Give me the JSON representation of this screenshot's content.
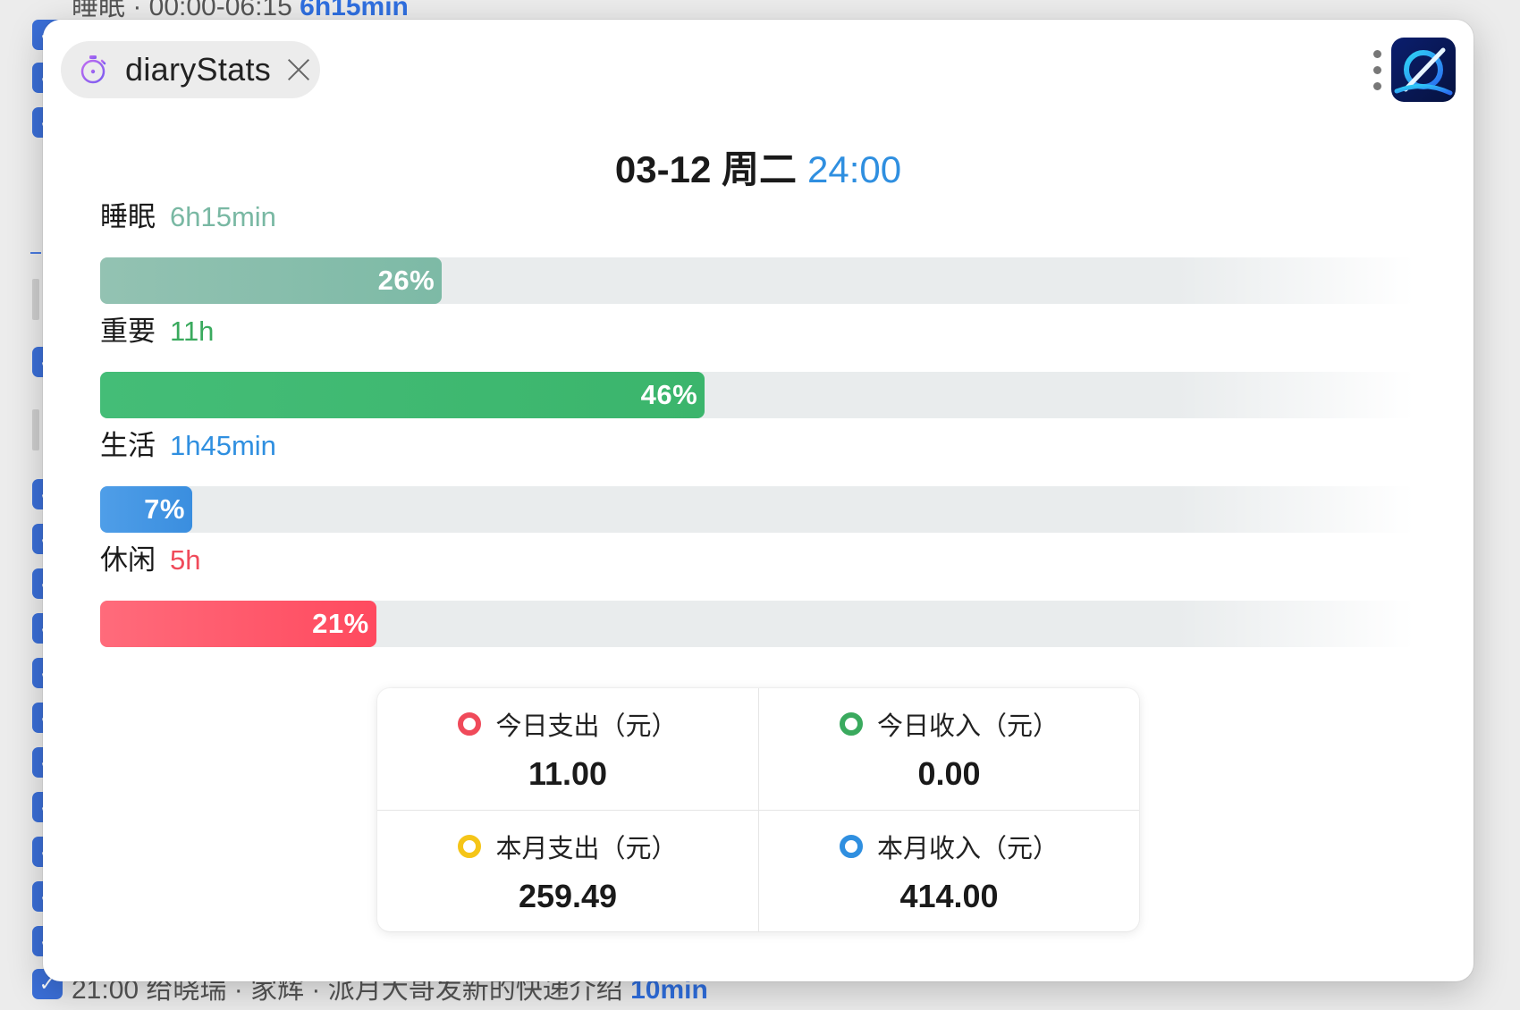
{
  "background_app": {
    "top_line": {
      "text": "睡眠 · 00:00-06:15",
      "highlight": "6h15min"
    },
    "bottom_line": {
      "text": "21:00 给晓瑞 · 家辉 · 派月大哥发新的快递介绍",
      "highlight": "10min"
    }
  },
  "tab": {
    "label": "diaryStats",
    "icon": "stopwatch-icon",
    "close_icon": "close-icon"
  },
  "header": {
    "menu_icon": "more-vertical-icon",
    "logo_icon": "app-logo-icon"
  },
  "date": {
    "day": "03-12 周二",
    "time": "24:00",
    "time_color": "#2f8fe0"
  },
  "categories": [
    {
      "name": "睡眠",
      "duration": "6h15min",
      "percent_label": "26%",
      "percent": 26,
      "color": "#7dbaa6",
      "color_light": "#93c2b2",
      "duration_color": "#79b8a3"
    },
    {
      "name": "重要",
      "duration": "11h",
      "percent_label": "46%",
      "percent": 46,
      "color": "#3bb56c",
      "color_light": "#44bd77",
      "duration_color": "#3aaa5e"
    },
    {
      "name": "生活",
      "duration": "1h45min",
      "percent_label": "7%",
      "percent": 7,
      "color": "#3a8edf",
      "color_light": "#4f9ee8",
      "duration_color": "#2f8fe0"
    },
    {
      "name": "休闲",
      "duration": "5h",
      "percent_label": "21%",
      "percent": 21,
      "color": "#ff4a5f",
      "color_light": "#ff6b7b",
      "duration_color": "#f04a5a"
    }
  ],
  "finance": [
    {
      "label": "今日支出（元）",
      "value": "11.00",
      "dot_color": "#f04a5a"
    },
    {
      "label": "今日收入（元）",
      "value": "0.00",
      "dot_color": "#3aaa5e"
    },
    {
      "label": "本月支出（元）",
      "value": "259.49",
      "dot_color": "#f5c518"
    },
    {
      "label": "本月收入（元）",
      "value": "414.00",
      "dot_color": "#2f8fe0"
    }
  ]
}
